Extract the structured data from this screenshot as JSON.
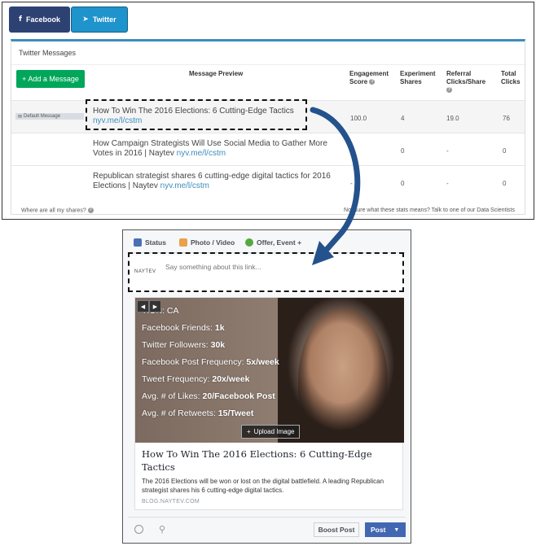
{
  "tabs": {
    "facebook": "Facebook",
    "twitter": "Twitter",
    "facebook_icon": "f",
    "twitter_icon": "🐦"
  },
  "box_title": "Twitter Messages",
  "add_button": "+ Add a Message",
  "columns": {
    "preview": "Message Preview",
    "engagement": [
      "Engagement",
      "Score"
    ],
    "experiment": [
      "Experiment",
      "Shares"
    ],
    "referral": [
      "Referral",
      "Clicks/Share"
    ],
    "total": [
      "Total",
      "Clicks"
    ]
  },
  "rows": [
    {
      "badge": "Default Message",
      "text": "How To Win The 2016 Elections: 6 Cutting-Edge Tactics",
      "link": "nyv.me/l/cstm",
      "engagement": "100.0",
      "shares": "4",
      "referral": "19.0",
      "total": "76"
    },
    {
      "badge": "",
      "text": "How Campaign Strategists Will Use Social Media to Gather More Votes in 2016 | Naytev",
      "link": "nyv.me/l/cstm",
      "engagement": "-",
      "shares": "0",
      "referral": "-",
      "total": "0"
    },
    {
      "badge": "",
      "text": "Republican strategist shares 6 cutting-edge digital tactics for 2016 Elections | Naytev",
      "link": "nyv.me/l/cstm",
      "engagement": "-",
      "shares": "0",
      "referral": "-",
      "total": "0"
    }
  ],
  "footer_left": "Where are all my shares?",
  "footer_right": "Not sure what these stats means? Talk to one of our Data Scientists",
  "facebook_composer": {
    "tabs": [
      "Status",
      "Photo / Video",
      "Offer, Event +"
    ],
    "logo": "NAYTEV",
    "placeholder": "Say something about this link...",
    "image_stats": [
      {
        "label": "TION: CA",
        "value": ""
      },
      {
        "label": "Facebook Friends: ",
        "value": "1k"
      },
      {
        "label": "Twitter Followers: ",
        "value": "30k"
      },
      {
        "label": "Facebook Post Frequency: ",
        "value": "5x/week"
      },
      {
        "label": "Tweet Frequency: ",
        "value": "20x/week"
      },
      {
        "label": "Avg. # of Likes: ",
        "value": "20/Facebook Post"
      },
      {
        "label": "Avg. # of Retweets: ",
        "value": "15/Tweet"
      }
    ],
    "upload_button": "Upload Image",
    "card_title": "How To Win The 2016 Elections: 6 Cutting-Edge Tactics",
    "card_description": "The 2016 Elections will be won or lost on the digital battlefield. A leading Republican strategist shares his 6 cutting-edge digital tactics.",
    "card_domain": "BLOG.NAYTEV.COM",
    "boost_button": "Boost Post",
    "post_button": "Post"
  },
  "colors": {
    "facebook_tab": "#2e4173",
    "twitter_tab": "#1f93cb",
    "add_button": "#00a65a",
    "link": "#3c8dbc",
    "post_button": "#4267b2",
    "arrow": "#24528c"
  }
}
